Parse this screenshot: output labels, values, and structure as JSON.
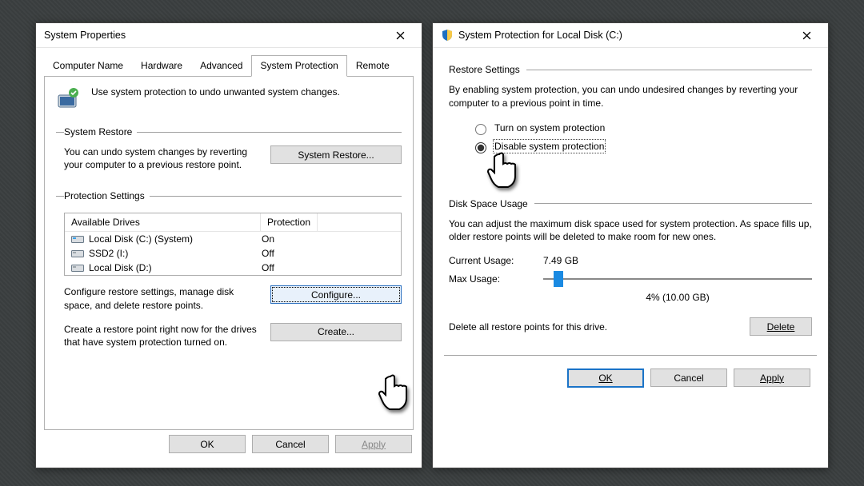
{
  "left": {
    "title": "System Properties",
    "tabs": [
      "Computer Name",
      "Hardware",
      "Advanced",
      "System Protection",
      "Remote"
    ],
    "active_tab": 3,
    "intro": "Use system protection to undo unwanted system changes.",
    "restore": {
      "legend": "System Restore",
      "text": "You can undo system changes by reverting your computer to a previous restore point.",
      "button": "System Restore..."
    },
    "protection": {
      "legend": "Protection Settings",
      "headers": [
        "Available Drives",
        "Protection"
      ],
      "drives": [
        {
          "name": "Local Disk (C:) (System)",
          "state": "On",
          "primary": true
        },
        {
          "name": "SSD2 (I:)",
          "state": "Off",
          "primary": false
        },
        {
          "name": "Local Disk (D:)",
          "state": "Off",
          "primary": false
        }
      ],
      "configure_text": "Configure restore settings, manage disk space, and delete restore points.",
      "configure_btn": "Configure...",
      "create_text": "Create a restore point right now for the drives that have system protection turned on.",
      "create_btn": "Create..."
    },
    "footer": {
      "ok": "OK",
      "cancel": "Cancel",
      "apply": "Apply"
    }
  },
  "right": {
    "title": "System Protection for Local Disk (C:)",
    "restore": {
      "legend": "Restore Settings",
      "text": "By enabling system protection, you can undo undesired changes by reverting your computer to a previous point in time.",
      "opt_on": "Turn on system protection",
      "opt_off": "Disable system protection",
      "selected": "off"
    },
    "disk": {
      "legend": "Disk Space Usage",
      "text": "You can adjust the maximum disk space used for system protection. As space fills up, older restore points will be deleted to make room for new ones.",
      "current_label": "Current Usage:",
      "current_value": "7.49 GB",
      "max_label": "Max Usage:",
      "slider_caption": "4% (10.00 GB)",
      "delete_text": "Delete all restore points for this drive.",
      "delete_btn": "Delete"
    },
    "footer": {
      "ok": "OK",
      "cancel": "Cancel",
      "apply": "Apply"
    }
  }
}
